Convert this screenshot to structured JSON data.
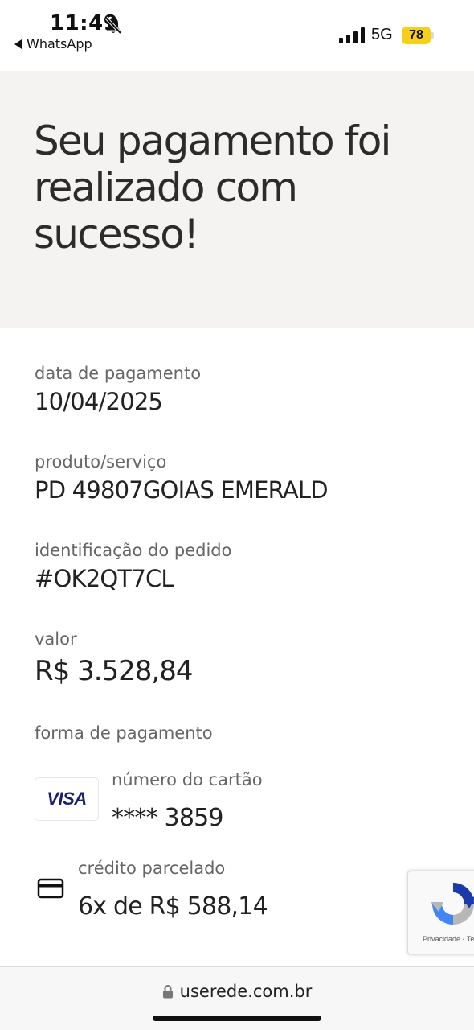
{
  "status_bar": {
    "time": "11:49",
    "back_app": "WhatsApp",
    "network": "5G",
    "battery": "78",
    "battery_color": "#f5cf1a"
  },
  "hero": {
    "title": "Seu pagamento foi realizado com sucesso!",
    "background": "#f4f3f1"
  },
  "details": {
    "payment_date": {
      "label": "data de pagamento",
      "value": "10/04/2025"
    },
    "product": {
      "label": "produto/serviço",
      "value": "PD 49807GOIAS EMERALD"
    },
    "order_id": {
      "label": "identificação do pedido",
      "value": "#OK2QT7CL"
    },
    "amount": {
      "label": "valor",
      "value": "R$ 3.528,84"
    },
    "payment_method": {
      "label": "forma de pagamento",
      "card_brand": "VISA",
      "card_number_label": "número do cartão",
      "card_number": "**** 3859",
      "installment_label": "crédito parcelado",
      "installment_value": "6x de R$ 588,14"
    }
  },
  "recaptcha": {
    "text": "Privacidade - Te"
  },
  "browser": {
    "url": "userede.com.br"
  },
  "icons": {
    "bell_muted": "bell-slash-icon",
    "signal": "signal-bars-icon",
    "battery": "battery-icon",
    "card": "credit-card-icon",
    "lock": "lock-icon",
    "recaptcha": "recaptcha-icon"
  }
}
